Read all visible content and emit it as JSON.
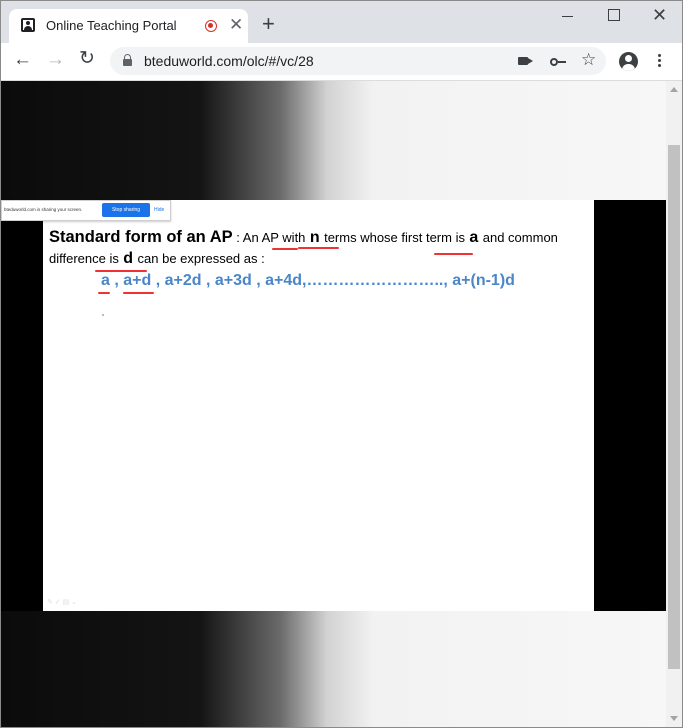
{
  "browser": {
    "tab_title": "Online Teaching Portal",
    "url": "bteduworld.com/olc/#/vc/28",
    "icons": [
      "portal-favicon-icon",
      "recording-icon",
      "close-icon",
      "new-tab-icon",
      "minimize-icon",
      "maximize-icon",
      "window-close-icon",
      "back-icon",
      "forward-icon",
      "reload-icon",
      "lock-icon",
      "camera-icon",
      "key-icon",
      "star-icon",
      "profile-icon",
      "menu-icon"
    ]
  },
  "share_bar": {
    "message": "bteduworld.com is sharing your screen.",
    "stop_label": "Stop sharing",
    "hide_label": "Hide"
  },
  "slide": {
    "heading": "Standard form of an AP",
    "line1_a": " : An AP ",
    "line1_with": "with",
    "line1_n": " n ",
    "line1_terms": "terms",
    "line1_b": " whose first ",
    "line1_term_is": "term is",
    "line1_a_var": " a ",
    "line1_c": "and common",
    "line2_diff": "difference is",
    "line2_d": " d ",
    "line2_rest": "can be expressed as :",
    "formula_a": "a",
    "formula_sep1": " , ",
    "formula_apd": "a+d",
    "formula_rest": " , a+2d , a+3d , a+4d,…………………….., a+(n-1)d"
  },
  "colors": {
    "formula_blue": "#4a86c8",
    "annotation_red": "#e33333",
    "stop_button": "#1a73e8"
  }
}
